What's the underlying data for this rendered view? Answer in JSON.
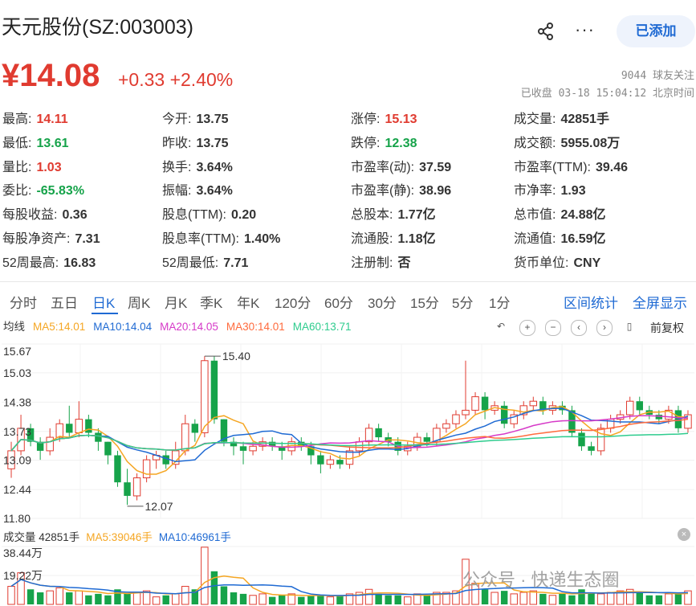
{
  "header": {
    "title": "天元股份(SZ:003003)",
    "add_label": "已添加",
    "more_label": "···"
  },
  "quote": {
    "price": "¥14.08",
    "change": "+0.33 +2.40%",
    "followers": "9044 球友关注",
    "status": "已收盘 03-18 15:04:12 北京时间"
  },
  "stats": [
    {
      "label": "最高:",
      "value": "14.11",
      "color": "red"
    },
    {
      "label": "今开:",
      "value": "13.75",
      "color": ""
    },
    {
      "label": "涨停:",
      "value": "15.13",
      "color": "red"
    },
    {
      "label": "成交量:",
      "value": "42851手",
      "color": ""
    },
    {
      "label": "最低:",
      "value": "13.61",
      "color": "green"
    },
    {
      "label": "昨收:",
      "value": "13.75",
      "color": ""
    },
    {
      "label": "跌停:",
      "value": "12.38",
      "color": "green"
    },
    {
      "label": "成交额:",
      "value": "5955.08万",
      "color": ""
    },
    {
      "label": "量比:",
      "value": "1.03",
      "color": "red"
    },
    {
      "label": "换手:",
      "value": "3.64%",
      "color": ""
    },
    {
      "label": "市盈率(动):",
      "value": "37.59",
      "color": ""
    },
    {
      "label": "市盈率(TTM):",
      "value": "39.46",
      "color": ""
    },
    {
      "label": "委比:",
      "value": "-65.83%",
      "color": "green"
    },
    {
      "label": "振幅:",
      "value": "3.64%",
      "color": ""
    },
    {
      "label": "市盈率(静):",
      "value": "38.96",
      "color": ""
    },
    {
      "label": "市净率:",
      "value": "1.93",
      "color": ""
    },
    {
      "label": "每股收益:",
      "value": "0.36",
      "color": ""
    },
    {
      "label": "股息(TTM):",
      "value": "0.20",
      "color": ""
    },
    {
      "label": "总股本:",
      "value": "1.77亿",
      "color": ""
    },
    {
      "label": "总市值:",
      "value": "24.88亿",
      "color": ""
    },
    {
      "label": "每股净资产:",
      "value": "7.31",
      "color": ""
    },
    {
      "label": "股息率(TTM):",
      "value": "1.40%",
      "color": ""
    },
    {
      "label": "流通股:",
      "value": "1.18亿",
      "color": ""
    },
    {
      "label": "流通值:",
      "value": "16.59亿",
      "color": ""
    },
    {
      "label": "52周最高:",
      "value": "16.83",
      "color": ""
    },
    {
      "label": "52周最低:",
      "value": "7.71",
      "color": ""
    },
    {
      "label": "注册制:",
      "value": "否",
      "color": ""
    },
    {
      "label": "货币单位:",
      "value": "CNY",
      "color": ""
    }
  ],
  "tabs": [
    "分时",
    "五日",
    "日K",
    "周K",
    "月K",
    "季K",
    "年K",
    "120分",
    "60分",
    "30分",
    "15分",
    "5分",
    "1分"
  ],
  "active_tab": "日K",
  "tab_actions": [
    "区间统计",
    "全屏显示"
  ],
  "ma_legend": {
    "label": "均线",
    "items": [
      {
        "text": "MA5:14.01",
        "color": "#f5a623"
      },
      {
        "text": "MA10:14.04",
        "color": "#1f6ad3"
      },
      {
        "text": "MA20:14.05",
        "color": "#d63ac8"
      },
      {
        "text": "MA30:14.01",
        "color": "#ff6b3d"
      },
      {
        "text": "MA60:13.71",
        "color": "#2ecc8e"
      }
    ]
  },
  "chart_controls": [
    "undo-icon",
    "zoom-in-icon",
    "zoom-out-icon",
    "chevron-left-icon",
    "chevron-right-icon",
    "candle-icon"
  ],
  "fuquan_label": "前复权",
  "volume_legend": {
    "items": [
      {
        "text": "成交量 42851手",
        "color": "#333"
      },
      {
        "text": "MA5:39046手",
        "color": "#f5a623"
      },
      {
        "text": "MA10:46961手",
        "color": "#1f6ad3"
      }
    ]
  },
  "watermark": "公众号 · 快递生态圈",
  "colors": {
    "up": "#e03b30",
    "down": "#16a34a",
    "accent": "#1f6ad3"
  },
  "chart_data": {
    "type": "candlestick",
    "price_axis_ticks": [
      "15.67",
      "15.03",
      "14.38",
      "13.73",
      "13.09",
      "12.44",
      "11.80"
    ],
    "ylim": [
      11.8,
      15.67
    ],
    "annotations": [
      {
        "text": "15.40",
        "value": 15.4
      },
      {
        "text": "12.07",
        "value": 12.07
      }
    ],
    "volume_axis_ticks": [
      "38.44万",
      "19.22万"
    ],
    "volume_ylim": [
      0,
      38.44
    ],
    "candles": [
      {
        "o": 12.9,
        "c": 13.3,
        "h": 13.5,
        "l": 12.7
      },
      {
        "o": 13.3,
        "c": 13.8,
        "h": 14.1,
        "l": 13.2
      },
      {
        "o": 13.8,
        "c": 13.5,
        "h": 13.9,
        "l": 13.4
      },
      {
        "o": 13.5,
        "c": 13.3,
        "h": 13.6,
        "l": 13.1
      },
      {
        "o": 13.3,
        "c": 13.6,
        "h": 13.8,
        "l": 13.2
      },
      {
        "o": 13.6,
        "c": 13.9,
        "h": 14.0,
        "l": 13.5
      },
      {
        "o": 13.9,
        "c": 13.7,
        "h": 14.3,
        "l": 13.6
      },
      {
        "o": 13.7,
        "c": 14.0,
        "h": 14.4,
        "l": 13.6
      },
      {
        "o": 14.0,
        "c": 13.7,
        "h": 14.1,
        "l": 13.6
      },
      {
        "o": 13.7,
        "c": 13.5,
        "h": 13.8,
        "l": 13.3
      },
      {
        "o": 13.5,
        "c": 13.2,
        "h": 13.5,
        "l": 13.0
      },
      {
        "o": 13.2,
        "c": 12.6,
        "h": 13.3,
        "l": 12.5
      },
      {
        "o": 12.6,
        "c": 12.3,
        "h": 12.9,
        "l": 12.1
      },
      {
        "o": 12.3,
        "c": 12.7,
        "h": 12.8,
        "l": 12.2
      },
      {
        "o": 12.7,
        "c": 13.1,
        "h": 13.2,
        "l": 12.6
      },
      {
        "o": 13.1,
        "c": 13.2,
        "h": 13.3,
        "l": 12.9
      },
      {
        "o": 13.2,
        "c": 13.0,
        "h": 13.3,
        "l": 12.9
      },
      {
        "o": 13.0,
        "c": 13.3,
        "h": 13.5,
        "l": 12.9
      },
      {
        "o": 13.3,
        "c": 13.9,
        "h": 14.1,
        "l": 13.2
      },
      {
        "o": 13.9,
        "c": 13.7,
        "h": 14.0,
        "l": 13.5
      },
      {
        "o": 13.7,
        "c": 15.3,
        "h": 15.4,
        "l": 13.6
      },
      {
        "o": 15.3,
        "c": 14.0,
        "h": 15.4,
        "l": 13.9
      },
      {
        "o": 14.0,
        "c": 13.5,
        "h": 14.0,
        "l": 13.4
      },
      {
        "o": 13.5,
        "c": 13.4,
        "h": 13.6,
        "l": 13.2
      },
      {
        "o": 13.4,
        "c": 13.3,
        "h": 13.5,
        "l": 13.0
      },
      {
        "o": 13.3,
        "c": 13.4,
        "h": 13.5,
        "l": 13.2
      },
      {
        "o": 13.4,
        "c": 13.5,
        "h": 13.6,
        "l": 13.3
      },
      {
        "o": 13.5,
        "c": 13.4,
        "h": 13.6,
        "l": 13.3
      },
      {
        "o": 13.4,
        "c": 13.3,
        "h": 13.5,
        "l": 13.1
      },
      {
        "o": 13.3,
        "c": 13.5,
        "h": 13.6,
        "l": 13.2
      },
      {
        "o": 13.5,
        "c": 13.4,
        "h": 13.6,
        "l": 13.3
      },
      {
        "o": 13.4,
        "c": 13.2,
        "h": 13.5,
        "l": 13.0
      },
      {
        "o": 13.2,
        "c": 13.0,
        "h": 13.3,
        "l": 12.8
      },
      {
        "o": 13.0,
        "c": 13.1,
        "h": 13.2,
        "l": 12.9
      },
      {
        "o": 13.1,
        "c": 13.0,
        "h": 13.2,
        "l": 12.9
      },
      {
        "o": 13.0,
        "c": 13.3,
        "h": 13.4,
        "l": 12.9
      },
      {
        "o": 13.3,
        "c": 13.5,
        "h": 13.6,
        "l": 13.2
      },
      {
        "o": 13.5,
        "c": 13.8,
        "h": 13.9,
        "l": 13.4
      },
      {
        "o": 13.8,
        "c": 13.6,
        "h": 13.9,
        "l": 13.5
      },
      {
        "o": 13.6,
        "c": 13.5,
        "h": 13.7,
        "l": 13.4
      },
      {
        "o": 13.5,
        "c": 13.3,
        "h": 13.6,
        "l": 13.2
      },
      {
        "o": 13.3,
        "c": 13.4,
        "h": 13.5,
        "l": 13.2
      },
      {
        "o": 13.4,
        "c": 13.6,
        "h": 13.7,
        "l": 13.3
      },
      {
        "o": 13.6,
        "c": 13.5,
        "h": 13.7,
        "l": 13.4
      },
      {
        "o": 13.5,
        "c": 13.8,
        "h": 13.9,
        "l": 13.4
      },
      {
        "o": 13.8,
        "c": 13.9,
        "h": 14.0,
        "l": 13.7
      },
      {
        "o": 13.9,
        "c": 14.1,
        "h": 14.2,
        "l": 13.8
      },
      {
        "o": 14.1,
        "c": 14.2,
        "h": 15.3,
        "l": 14.0
      },
      {
        "o": 14.2,
        "c": 14.5,
        "h": 14.6,
        "l": 14.1
      },
      {
        "o": 14.5,
        "c": 14.2,
        "h": 14.6,
        "l": 14.0
      },
      {
        "o": 14.2,
        "c": 14.3,
        "h": 14.4,
        "l": 14.1
      },
      {
        "o": 14.3,
        "c": 13.9,
        "h": 14.4,
        "l": 13.8
      },
      {
        "o": 13.9,
        "c": 14.1,
        "h": 14.2,
        "l": 13.8
      },
      {
        "o": 14.1,
        "c": 14.3,
        "h": 14.4,
        "l": 14.0
      },
      {
        "o": 14.3,
        "c": 14.4,
        "h": 14.5,
        "l": 14.2
      },
      {
        "o": 14.4,
        "c": 14.2,
        "h": 14.5,
        "l": 14.1
      },
      {
        "o": 14.2,
        "c": 14.3,
        "h": 14.4,
        "l": 14.1
      },
      {
        "o": 14.3,
        "c": 14.2,
        "h": 14.4,
        "l": 14.1
      },
      {
        "o": 14.2,
        "c": 13.7,
        "h": 14.3,
        "l": 13.6
      },
      {
        "o": 13.7,
        "c": 13.4,
        "h": 13.8,
        "l": 13.3
      },
      {
        "o": 13.4,
        "c": 13.3,
        "h": 13.5,
        "l": 13.2
      },
      {
        "o": 13.3,
        "c": 13.8,
        "h": 13.9,
        "l": 13.2
      },
      {
        "o": 13.8,
        "c": 14.0,
        "h": 14.1,
        "l": 13.7
      },
      {
        "o": 14.0,
        "c": 14.1,
        "h": 14.2,
        "l": 13.9
      },
      {
        "o": 14.1,
        "c": 14.4,
        "h": 14.5,
        "l": 14.0
      },
      {
        "o": 14.4,
        "c": 14.2,
        "h": 14.5,
        "l": 14.1
      },
      {
        "o": 14.2,
        "c": 14.1,
        "h": 14.3,
        "l": 14.0
      },
      {
        "o": 14.1,
        "c": 14.0,
        "h": 14.2,
        "l": 13.9
      },
      {
        "o": 14.0,
        "c": 14.2,
        "h": 14.3,
        "l": 13.9
      },
      {
        "o": 14.2,
        "c": 13.8,
        "h": 14.3,
        "l": 13.7
      },
      {
        "o": 13.8,
        "c": 14.1,
        "h": 14.2,
        "l": 13.7
      }
    ],
    "volumes": [
      12,
      21,
      10,
      8,
      9,
      11,
      8,
      9,
      6,
      7,
      6,
      10,
      7,
      8,
      9,
      5,
      6,
      7,
      12,
      10,
      38,
      22,
      12,
      8,
      7,
      6,
      7,
      5,
      6,
      7,
      5,
      6,
      6,
      5,
      6,
      7,
      8,
      10,
      7,
      6,
      6,
      5,
      7,
      6,
      8,
      8,
      9,
      30,
      14,
      10,
      8,
      9,
      7,
      8,
      9,
      7,
      6,
      7,
      6,
      10,
      8,
      7,
      8,
      9,
      10,
      8,
      6,
      6,
      7,
      8,
      9
    ]
  }
}
